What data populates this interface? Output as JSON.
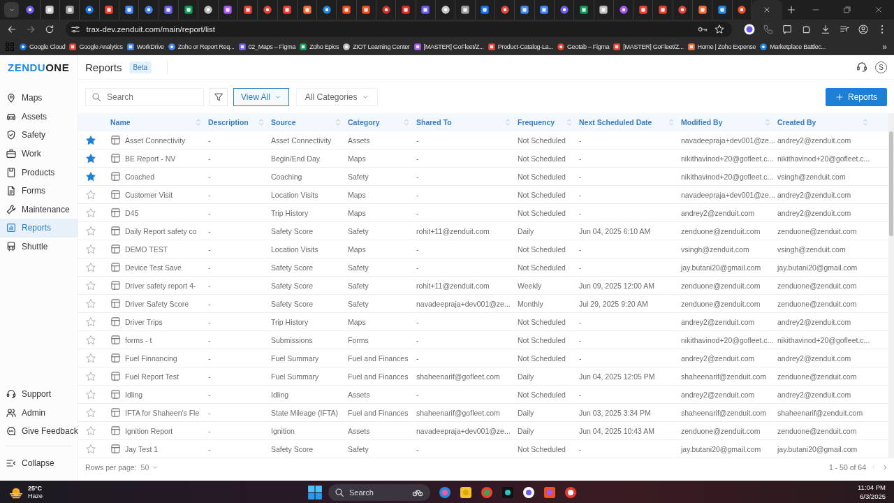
{
  "browser": {
    "tabs": [
      {
        "selected": false
      },
      {
        "selected": false
      },
      {
        "selected": false
      },
      {
        "selected": false
      },
      {
        "selected": false
      },
      {
        "selected": false
      },
      {
        "selected": false
      },
      {
        "selected": false
      },
      {
        "selected": false
      },
      {
        "selected": false
      },
      {
        "selected": false
      },
      {
        "selected": false
      },
      {
        "selected": false
      },
      {
        "selected": false
      },
      {
        "selected": false
      },
      {
        "selected": false
      },
      {
        "selected": false
      },
      {
        "selected": false
      },
      {
        "selected": false
      },
      {
        "selected": false
      },
      {
        "selected": false
      },
      {
        "selected": false
      },
      {
        "selected": false
      },
      {
        "selected": false
      },
      {
        "selected": false
      },
      {
        "selected": false
      },
      {
        "selected": false
      },
      {
        "selected": false
      },
      {
        "selected": false
      },
      {
        "selected": false
      },
      {
        "selected": false
      },
      {
        "selected": false
      },
      {
        "selected": false
      },
      {
        "selected": false
      },
      {
        "selected": false
      },
      {
        "selected": false
      },
      {
        "selected": false
      },
      {
        "selected": true
      }
    ],
    "url": "trax-dev.zenduit.com/main/report/list",
    "bookmarks": [
      "Google Cloud",
      "Google Analytics",
      "WorkDrive",
      "Zoho or Report Req...",
      "02_Maps – Figma",
      "Zoho Epics",
      "ZIOT Learning Center",
      "[MASTER] GoFleet/Z...",
      "Product-Catalog-La...",
      "Geotab – Figma",
      "[MASTER] GoFleet/Z...",
      "Home | Zoho Expense",
      "Marketplace Battlec..."
    ],
    "bookmarks_more": "»"
  },
  "logo_lead": "ZENDU",
  "logo_tail": "ONE",
  "header": {
    "title": "Reports",
    "badge": "Beta",
    "avatar": "S"
  },
  "sidebar": {
    "items": [
      {
        "label": "Maps",
        "selected": false
      },
      {
        "label": "Assets",
        "selected": false
      },
      {
        "label": "Safety",
        "selected": false
      },
      {
        "label": "Work",
        "selected": false
      },
      {
        "label": "Products",
        "selected": false
      },
      {
        "label": "Forms",
        "selected": false
      },
      {
        "label": "Maintenance",
        "selected": false
      },
      {
        "label": "Reports",
        "selected": true
      },
      {
        "label": "Shuttle",
        "selected": false
      }
    ],
    "bottom_items": [
      "Support",
      "Admin",
      "Give Feedback"
    ],
    "collapse": "Collapse"
  },
  "toolbar": {
    "search": {
      "placeholder": "Search"
    },
    "view_filter": "View All",
    "category_filter": "All Categories",
    "add_button": "Reports"
  },
  "table": {
    "columns": [
      "Name",
      "Description",
      "Source",
      "Category",
      "Shared To",
      "Frequency",
      "Next Scheduled Date",
      "Modified By",
      "Created By"
    ],
    "rows": [
      {
        "starred": true,
        "cells": [
          "Asset Connectivity",
          "-",
          "Asset Connectivity",
          "Assets",
          "-",
          "Not Scheduled",
          "-",
          "navadeepraja+dev001@ze...",
          "andrey2@zenduit.com"
        ]
      },
      {
        "starred": true,
        "cells": [
          "BE Report - NV",
          "-",
          "Begin/End Day",
          "Maps",
          "-",
          "Not Scheduled",
          "-",
          "nikithavinod+20@gofleet.c...",
          "nikithavinod+20@gofleet.c..."
        ]
      },
      {
        "starred": true,
        "cells": [
          "Coached",
          "-",
          "Coaching",
          "Safety",
          "-",
          "Not Scheduled",
          "-",
          "nikithavinod+20@gofleet.c...",
          "vsingh@zenduit.com"
        ]
      },
      {
        "starred": false,
        "cells": [
          "Customer Visit",
          "-",
          "Location Visits",
          "Maps",
          "-",
          "Not Scheduled",
          "-",
          "navadeepraja+dev001@ze...",
          "andrey2@zenduit.com"
        ]
      },
      {
        "starred": false,
        "cells": [
          "D45",
          "-",
          "Trip History",
          "Maps",
          "-",
          "Not Scheduled",
          "-",
          "andrey2@zenduit.com",
          "andrey2@zenduit.com"
        ]
      },
      {
        "starred": false,
        "cells": [
          "Daily Report safety co",
          "-",
          "Safety Score",
          "Safety",
          "rohit+11@zenduit.com",
          "Daily",
          "Jun 04, 2025 6:10 AM",
          "zenduone@zenduit.com",
          "zenduone@zenduit.com"
        ]
      },
      {
        "starred": false,
        "cells": [
          "DEMO TEST",
          "-",
          "Location Visits",
          "Maps",
          "-",
          "Not Scheduled",
          "-",
          "vsingh@zenduit.com",
          "vsingh@zenduit.com"
        ]
      },
      {
        "starred": false,
        "cells": [
          "Device Test Save",
          "-",
          "Safety Score",
          "Safety",
          "-",
          "Not Scheduled",
          "-",
          "jay.butani20@gmail.com",
          "jay.butani20@gmail.com"
        ]
      },
      {
        "starred": false,
        "cells": [
          "Driver safety report 4-",
          "-",
          "Safety Score",
          "Safety",
          "rohit+11@zenduit.com",
          "Weekly",
          "Jun 09, 2025 12:00 AM",
          "zenduone@zenduit.com",
          "zenduone@zenduit.com"
        ]
      },
      {
        "starred": false,
        "cells": [
          "Driver Safety Score",
          "-",
          "Safety Score",
          "Safety",
          "navadeepraja+dev001@ze...",
          "Monthly",
          "Jul 29, 2025 9:20 AM",
          "zenduone@zenduit.com",
          "zenduone@zenduit.com"
        ]
      },
      {
        "starred": false,
        "cells": [
          "Driver Trips",
          "-",
          "Trip History",
          "Maps",
          "-",
          "Not Scheduled",
          "-",
          "andrey2@zenduit.com",
          "andrey2@zenduit.com"
        ]
      },
      {
        "starred": false,
        "cells": [
          "forms - t",
          "-",
          "Submissions",
          "Forms",
          "-",
          "Not Scheduled",
          "-",
          "nikithavinod+20@gofleet.c...",
          "nikithavinod+20@gofleet.c..."
        ]
      },
      {
        "starred": false,
        "cells": [
          "Fuel Finnancing",
          "-",
          "Fuel Summary",
          "Fuel and Finances",
          "-",
          "Not Scheduled",
          "-",
          "andrey2@zenduit.com",
          "andrey2@zenduit.com"
        ]
      },
      {
        "starred": false,
        "cells": [
          "Fuel Report Test",
          "-",
          "Fuel Summary",
          "Fuel and Finances",
          "shaheenarif@gofleet.com",
          "Daily",
          "Jun 04, 2025 12:05 PM",
          "shaheenarif@zenduit.com",
          "zenduone@zenduit.com"
        ]
      },
      {
        "starred": false,
        "cells": [
          "Idling",
          "-",
          "Idling",
          "Assets",
          "-",
          "Not Scheduled",
          "-",
          "andrey2@zenduit.com",
          "andrey2@zenduit.com"
        ]
      },
      {
        "starred": false,
        "cells": [
          "IFTA for Shaheen's Fle",
          "-",
          "State Mileage (IFTA)",
          "Fuel and Finances",
          "shaheenarif@gofleet.com",
          "Daily",
          "Jun 03, 2025 3:34 PM",
          "shaheenarif@zenduit.com",
          "shaheenarif@zenduit.com"
        ]
      },
      {
        "starred": false,
        "cells": [
          "Ignition Report",
          "-",
          "Ignition",
          "Assets",
          "navadeepraja+dev001@ze...",
          "Daily",
          "Jun 04, 2025 10:43 AM",
          "zenduone@zenduit.com",
          "zenduone@zenduit.com"
        ]
      },
      {
        "starred": false,
        "cells": [
          "Jay Test 1",
          "-",
          "Safety Score",
          "Safety",
          "-",
          "Not Scheduled",
          "-",
          "jay.butani20@gmail.com",
          "jay.butani20@gmail.com"
        ]
      }
    ]
  },
  "pagination": {
    "rows_label": "Rows per page:",
    "rows_value": "50",
    "range": "1 - 50 of 64",
    "prev_disabled": true,
    "next_disabled": false
  },
  "taskbar": {
    "temperature": "25°C",
    "condition": "Haze",
    "search_placeholder": "Search",
    "time": "11:04 PM",
    "date": "6/3/2025"
  }
}
